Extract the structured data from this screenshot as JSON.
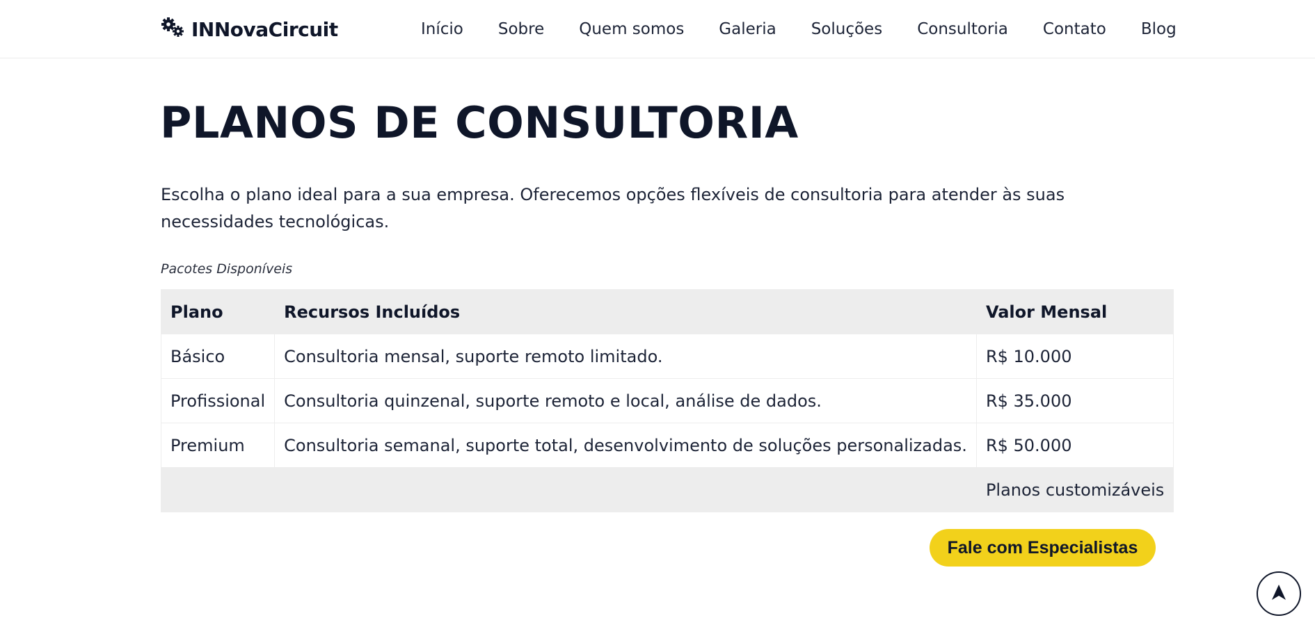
{
  "header": {
    "brand": "INNovaCircuit",
    "brand_icon": "gears-icon",
    "nav": [
      "Início",
      "Sobre",
      "Quem somos",
      "Galeria",
      "Soluções",
      "Consultoria",
      "Contato",
      "Blog"
    ]
  },
  "main": {
    "title": "PLANOS DE CONSULTORIA",
    "intro": "Escolha o plano ideal para a sua empresa. Oferecemos opções flexíveis de consultoria para atender às suas necessidades tecnológicas.",
    "table": {
      "caption": "Pacotes Disponíveis",
      "headers": [
        "Plano",
        "Recursos Incluídos",
        "Valor Mensal"
      ],
      "rows": [
        [
          "Básico",
          "Consultoria mensal, suporte remoto limitado.",
          "R$ 10.000"
        ],
        [
          "Profissional",
          "Consultoria quinzenal, suporte remoto e local, análise de dados.",
          "R$ 35.000"
        ],
        [
          "Premium",
          "Consultoria semanal, suporte total, desenvolvimento de soluções personalizadas.",
          "R$ 50.000"
        ]
      ],
      "footer": "Planos customizáveis"
    },
    "cta_label": "Fale com Especialistas"
  },
  "scroll_top_icon": "arrow-up-icon",
  "colors": {
    "text_dark": "#0f1629",
    "accent_yellow": "#f2d11b",
    "table_header_bg": "#ededed"
  }
}
